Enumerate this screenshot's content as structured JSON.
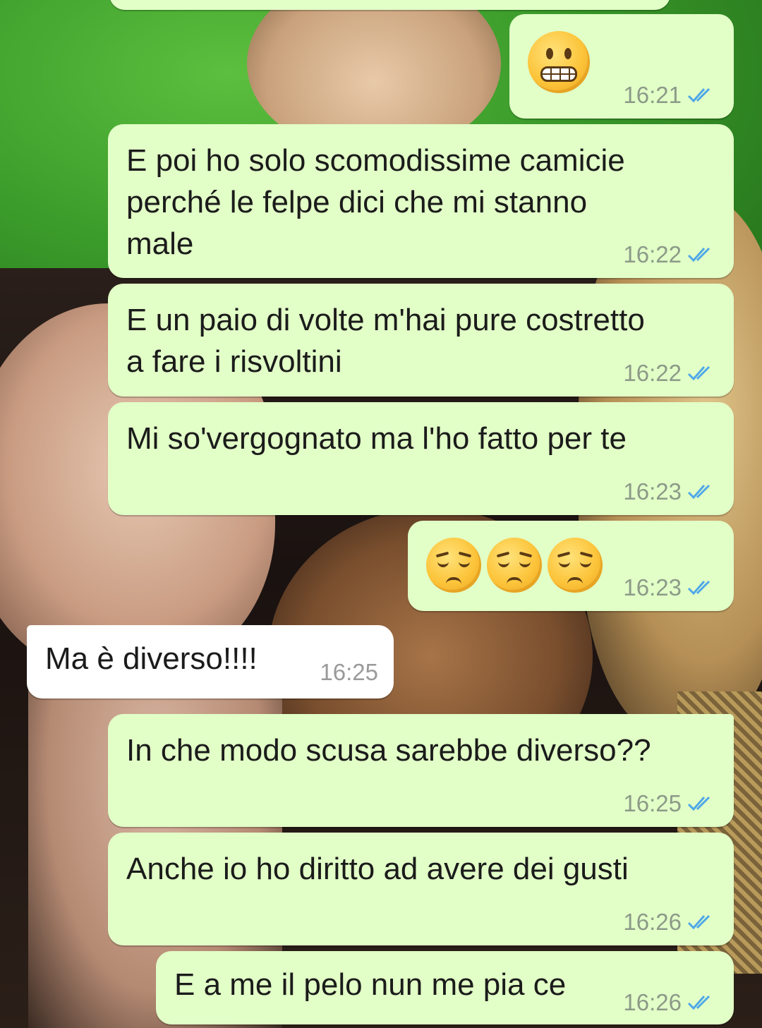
{
  "colors": {
    "outgoing_bubble": "#e2ffc7",
    "incoming_bubble": "#ffffff",
    "read_ticks": "#4fa8e8",
    "timestamp": "#8c9a88"
  },
  "messages": [
    {
      "direction": "out",
      "text": "",
      "emoji": [
        "grimacing-face"
      ],
      "time": "16:21",
      "status": "read"
    },
    {
      "direction": "out",
      "text": "E poi ho solo scomodissime camicie\nperché le felpe dici che mi stanno\nmale",
      "time": "16:22",
      "status": "read"
    },
    {
      "direction": "out",
      "text": "E un paio di volte m'hai pure costretto\na fare i risvoltini",
      "time": "16:22",
      "status": "read"
    },
    {
      "direction": "out",
      "text": "Mi so'vergognato ma l'ho fatto per te",
      "time": "16:23",
      "status": "read"
    },
    {
      "direction": "out",
      "text": "",
      "emoji": [
        "pensive-face",
        "pensive-face",
        "pensive-face"
      ],
      "time": "16:23",
      "status": "read"
    },
    {
      "direction": "in",
      "text": "Ma è diverso!!!!",
      "time": "16:25"
    },
    {
      "direction": "out",
      "text": "In che modo scusa sarebbe diverso??",
      "time": "16:25",
      "status": "read"
    },
    {
      "direction": "out",
      "text": "Anche io ho diritto ad avere dei gusti",
      "time": "16:26",
      "status": "read"
    },
    {
      "direction": "out",
      "text": "E a me il pelo nun me pia ce",
      "time": "16:26",
      "status": "read"
    }
  ]
}
